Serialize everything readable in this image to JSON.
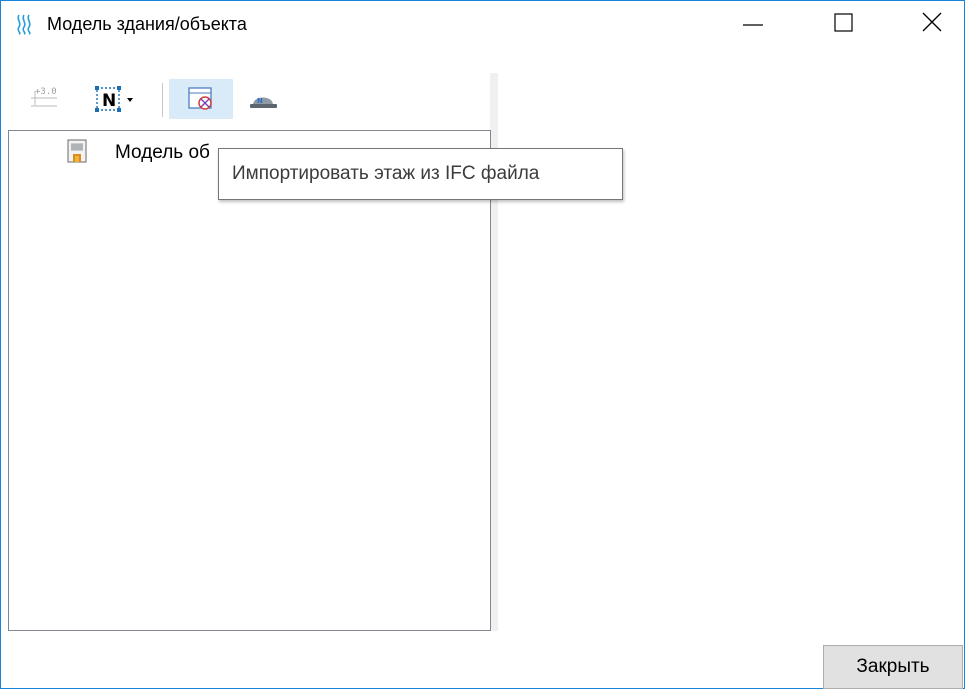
{
  "window": {
    "title": "Модель здания/объекта"
  },
  "toolbar": {
    "level_icon_text": "+3.0",
    "north_icon_text": "N",
    "import_tooltip": "Импортировать этаж из IFC файла"
  },
  "tree": {
    "items": [
      {
        "label": "Модель об",
        "icon": "building-icon"
      }
    ]
  },
  "footer": {
    "close_label": "Закрыть"
  },
  "colors": {
    "window_border": "#1883d7",
    "button_face": "#e1e1e1",
    "hover_highlight": "#d9ebf9"
  }
}
